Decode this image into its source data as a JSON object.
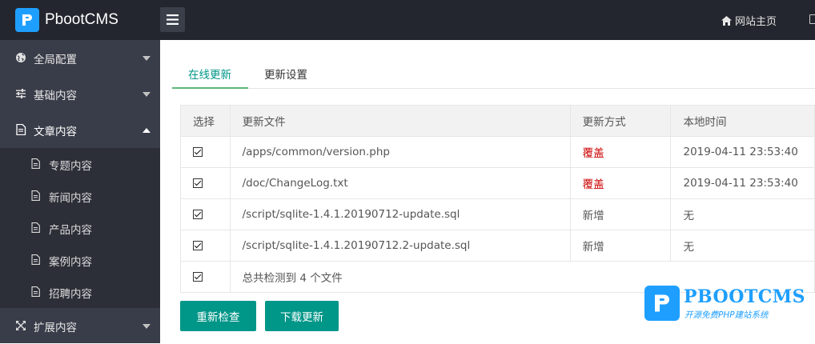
{
  "header": {
    "brand": "PbootCMS",
    "home_link": "网站主页",
    "brand_color": "#1e9fff"
  },
  "sidebar": {
    "items": [
      {
        "label": "全局配置",
        "icon": "globe-icon"
      },
      {
        "label": "基础内容",
        "icon": "sliders-icon"
      },
      {
        "label": "文章内容",
        "icon": "file-icon"
      },
      {
        "label": "扩展内容",
        "icon": "expand-icon"
      }
    ],
    "sub_items": [
      {
        "label": "专题内容",
        "icon": "file-icon"
      },
      {
        "label": "新闻内容",
        "icon": "file-icon"
      },
      {
        "label": "产品内容",
        "icon": "file-icon"
      },
      {
        "label": "案例内容",
        "icon": "file-icon"
      },
      {
        "label": "招聘内容",
        "icon": "file-icon"
      }
    ]
  },
  "tabs": [
    {
      "label": "在线更新",
      "active": true
    },
    {
      "label": "更新设置",
      "active": false
    }
  ],
  "table": {
    "headers": [
      "选择",
      "更新文件",
      "更新方式",
      "本地时间"
    ],
    "rows": [
      {
        "file": "/apps/common/version.php",
        "mode": "覆盖",
        "time": "2019-04-11 23:53:40"
      },
      {
        "file": "/doc/ChangeLog.txt",
        "mode": "覆盖",
        "time": "2019-04-11 23:53:40"
      },
      {
        "file": "/script/sqlite-1.4.1.20190712-update.sql",
        "mode": "新增",
        "time": "无"
      },
      {
        "file": "/script/sqlite-1.4.1.20190712.2-update.sql",
        "mode": "新增",
        "time": "无"
      }
    ],
    "summary": "总共检测到 4 个文件"
  },
  "buttons": {
    "recheck": "重新检查",
    "download": "下载更新"
  },
  "watermark": {
    "title": "PBOOTCMS",
    "subtitle": "开源免费PHP建站系统"
  },
  "colors": {
    "accent": "#009688",
    "cover_mode": "#cc0000",
    "sidebar": "#393d49",
    "topbar": "#23262e"
  }
}
